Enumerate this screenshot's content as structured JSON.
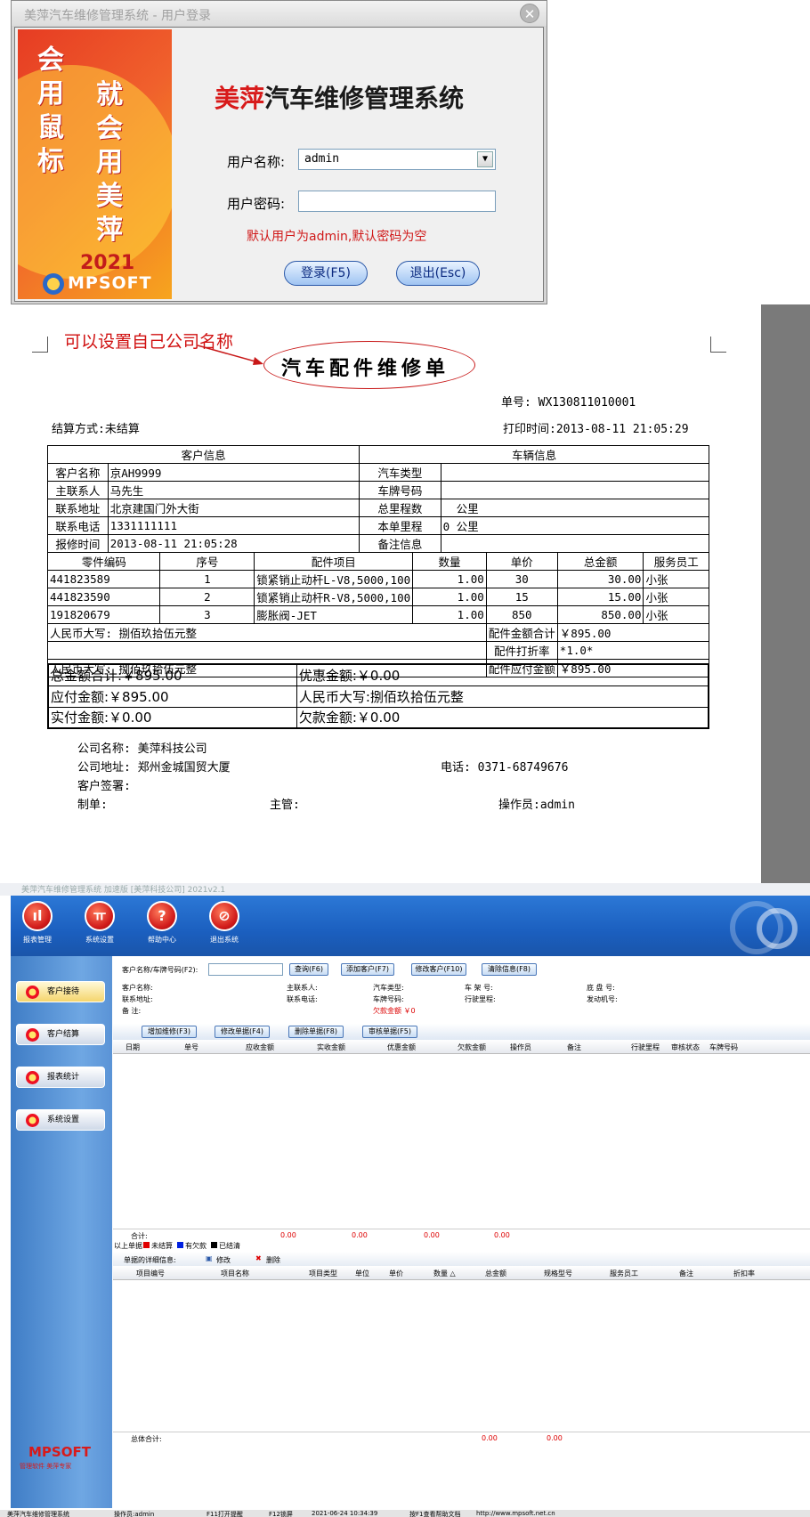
{
  "login": {
    "title": "美萍汽车维修管理系统 - 用户登录",
    "banner_left": "会用鼠标",
    "banner_right": "就会用美萍",
    "brand_year": "2021",
    "brand_logo": "MPSOFT",
    "app_name_red": "美萍",
    "app_name_rest": "汽车维修管理系统",
    "username_label": "用户名称:",
    "username_value": "admin",
    "password_label": "用户密码:",
    "password_value": "",
    "hint": "默认用户为admin,默认密码为空",
    "login_button": "登录(F5)",
    "exit_button": "退出(Esc)"
  },
  "invoice": {
    "annotation": "可以设置自己公司名称",
    "title": "汽车配件维修单",
    "order_no": "单号: WX130811010001",
    "settle": "结算方式:未结算",
    "print_time": "打印时间:2013-08-11 21:05:29",
    "customer_header": "客户信息",
    "vehicle_header": "车辆信息",
    "customer_rows": [
      {
        "label": "客户名称",
        "value": "京AH9999",
        "vlabel": "汽车类型",
        "vvalue": ""
      },
      {
        "label": "主联系人",
        "value": "马先生",
        "vlabel": "车牌号码",
        "vvalue": ""
      },
      {
        "label": "联系地址",
        "value": "北京建国门外大街",
        "vlabel": "总里程数",
        "vvalue": "  公里"
      },
      {
        "label": "联系电话",
        "value": "1331111111",
        "vlabel": "本单里程",
        "vvalue": "0 公里"
      },
      {
        "label": "报修时间",
        "value": "2013-08-11 21:05:28",
        "vlabel": "备注信息",
        "vvalue": ""
      }
    ],
    "part_headers": [
      "零件编码",
      "序号",
      "配件项目",
      "数量",
      "单价",
      "总金额",
      "服务员工"
    ],
    "parts": [
      [
        "441823589",
        "1",
        "锁紧销止动杆L-V8,5000,100",
        "1.00",
        "30",
        "30.00",
        "小张"
      ],
      [
        "441823590",
        "2",
        "锁紧销止动杆R-V8,5000,100",
        "1.00",
        "15",
        "15.00",
        "小张"
      ],
      [
        "191820679",
        "3",
        "膨胀阀-JET",
        "1.00",
        "850",
        "850.00",
        "小张"
      ]
    ],
    "rmb1": "人民币大写: 捌佰玖拾伍元整",
    "parts_total_label": "配件金额合计",
    "parts_total_value": "￥895.00",
    "discount_label": "配件打折率",
    "discount_value": "*1.0*",
    "rmb2": "人民币大写: 捌佰玖拾伍元整",
    "parts_due_label": "配件应付金额",
    "parts_due_value": "￥895.00",
    "total": "总金额合计:￥895.00",
    "discount_amount": "优惠金额:￥0.00",
    "due": "应付金额:￥895.00",
    "rmb3": "人民币大写:捌佰玖拾伍元整",
    "paid": "实付金额:￥0.00",
    "owed": "欠款金额:￥0.00",
    "company": "公司名称: 美萍科技公司",
    "address": "公司地址: 郑州金城国贸大厦",
    "phone": "电话: 0371-68749676",
    "sign": "客户签署:",
    "maker": "制单:",
    "manager": "主管:",
    "operator": "操作员:admin"
  },
  "app": {
    "title": "美萍汽车维修管理系统 加速版 [美萍科技公司]  2021v2.1",
    "toolbar": [
      "报表管理",
      "系统设置",
      "帮助中心",
      "退出系统"
    ],
    "toolbar_icons": [
      "chart-icon",
      "tools-icon",
      "help-icon",
      "exit-icon"
    ],
    "sidebar": [
      "客户接待",
      "客户结算",
      "报表统计",
      "系统设置"
    ],
    "brand": "MPSOFT",
    "brand_sub": "管理软件  美萍专家",
    "search_label": "客户名称/车牌号码(F2):",
    "buttons_top": [
      "查询(F6)",
      "添加客户(F7)",
      "修改客户(F10)",
      "清除信息(F8)"
    ],
    "info_labels": [
      [
        "客户名称:",
        "主联系人:",
        "汽车类型:",
        "车 架 号:",
        "底 盘 号:"
      ],
      [
        "联系地址:",
        "联系电话:",
        "车牌号码:",
        "行驶里程:",
        "发动机号:"
      ],
      [
        "备    注:",
        "",
        "欠款金额 ￥0",
        "",
        ""
      ]
    ],
    "buttons_mid": [
      "增加维修(F3)",
      "修改单据(F4)",
      "删除单据(F8)",
      "审核单据(F5)"
    ],
    "grid1_headers": [
      "日期",
      "单号",
      "应收金额",
      "实收金额",
      "优惠金额",
      "欠款金额",
      "操作员",
      "备注",
      "行驶里程",
      "审核状态",
      "车牌号码"
    ],
    "sum_label": "合计:",
    "sum_values": [
      "0.00",
      "0.00",
      "0.00",
      "0.00"
    ],
    "legend_prefix": "以上单据:",
    "legend": [
      "未结算",
      "有欠款",
      "已结清"
    ],
    "legend_colors": [
      "#e00000",
      "#0020e0",
      "#000000"
    ],
    "detail_label": "单据的详细信息:",
    "detail_edit": "修改",
    "detail_delete": "删除",
    "grid2_headers": [
      "项目编号",
      "项目名称",
      "项目类型",
      "单位",
      "单价",
      "数量 △",
      "总金额",
      "规格型号",
      "服务员工",
      "备注",
      "折扣率"
    ],
    "grand_label": "总体合计:",
    "grand_values": [
      "0.00",
      "0.00"
    ],
    "status": [
      "美萍汽车维修管理系统",
      "操作员:admin",
      "F11打开提醒",
      "F12锁屏",
      "2021-06-24 10:34:39",
      "按F1查看帮助文档",
      "http://www.mpsoft.net.cn"
    ]
  }
}
